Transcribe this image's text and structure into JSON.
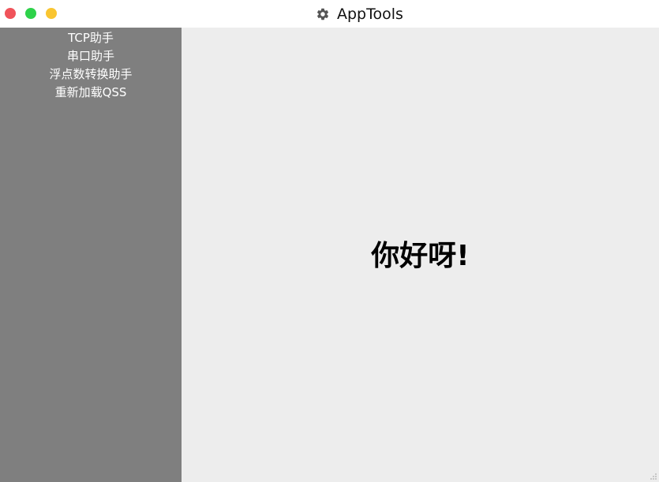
{
  "window": {
    "title": "AppTools",
    "title_icon": "gear-icon",
    "controls": {
      "close_color": "#f0535a",
      "maximize_color": "#2ed24a",
      "minimize_color": "#f9c531"
    }
  },
  "sidebar": {
    "background": "#7f7f7f",
    "items": [
      {
        "label": "TCP助手"
      },
      {
        "label": "串口助手"
      },
      {
        "label": "浮点数转换助手"
      },
      {
        "label": "重新加载QSS"
      }
    ]
  },
  "main": {
    "background": "#ededed",
    "greeting": "你好呀!"
  }
}
